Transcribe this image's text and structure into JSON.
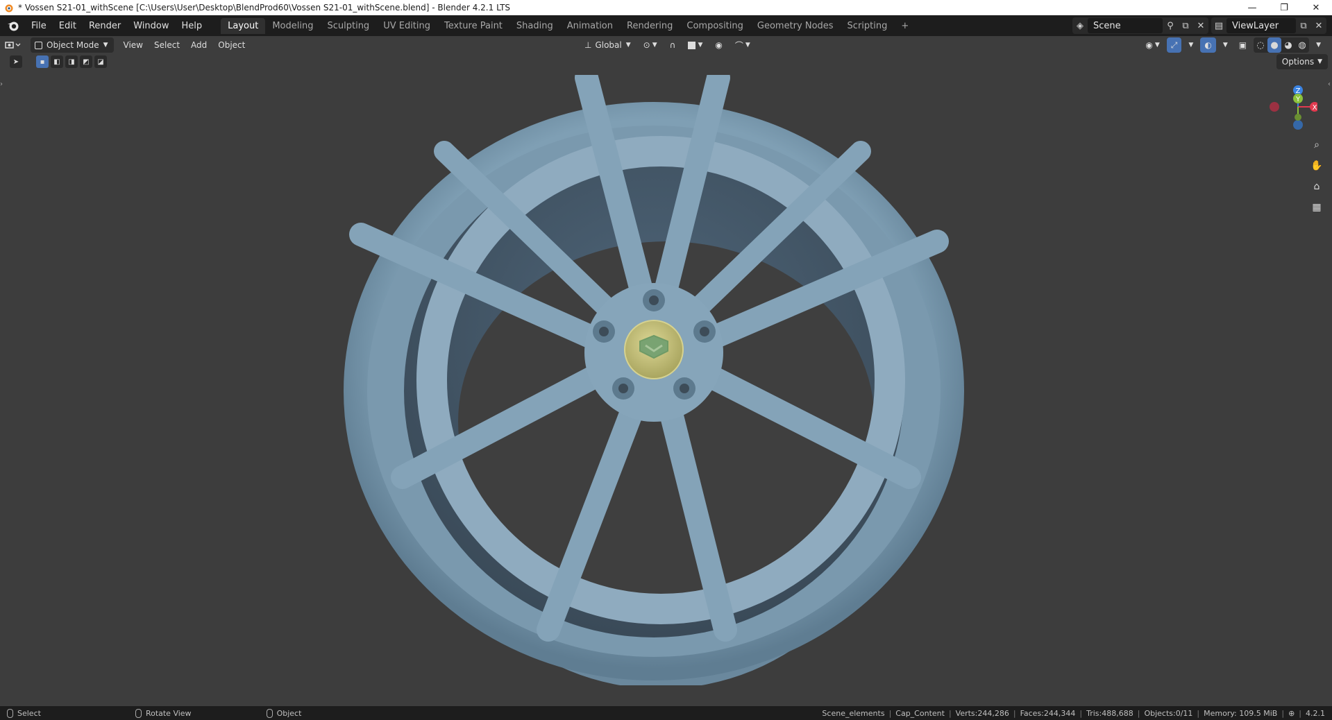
{
  "window": {
    "title": "* Vossen S21-01_withScene [C:\\Users\\User\\Desktop\\BlendProd60\\Vossen S21-01_withScene.blend] - Blender 4.2.1 LTS",
    "controls": [
      "—",
      "❐",
      "✕"
    ]
  },
  "menu": [
    "File",
    "Edit",
    "Render",
    "Window",
    "Help"
  ],
  "workspaces": [
    {
      "label": "Layout",
      "active": true
    },
    {
      "label": "Modeling"
    },
    {
      "label": "Sculpting"
    },
    {
      "label": "UV Editing"
    },
    {
      "label": "Texture Paint"
    },
    {
      "label": "Shading"
    },
    {
      "label": "Animation"
    },
    {
      "label": "Rendering"
    },
    {
      "label": "Compositing"
    },
    {
      "label": "Geometry Nodes"
    },
    {
      "label": "Scripting"
    }
  ],
  "workspace_add": "+",
  "scene": {
    "label": "Scene"
  },
  "view_layer": {
    "label": "ViewLayer"
  },
  "viewport_header": {
    "mode": "Object Mode",
    "menus": [
      "View",
      "Select",
      "Add",
      "Object"
    ],
    "transform_orientation": "Global"
  },
  "options_label": "Options",
  "gizmo": {
    "axes": [
      "X",
      "Y",
      "Z"
    ],
    "colors": {
      "x": "#e23a4f",
      "y": "#8bc13b",
      "z": "#3a83e2"
    }
  },
  "status": {
    "hints": [
      "Select",
      "Rotate View",
      "Object"
    ],
    "collection": "Scene_elements",
    "active": "Cap_Content",
    "verts": "Verts:244,286",
    "faces": "Faces:244,344",
    "tris": "Tris:488,688",
    "objects": "Objects:0/11",
    "memory": "Memory: 109.5 MiB",
    "version": "4.2.1"
  },
  "colors": {
    "wheel": "#7f9fb4",
    "cap": "#c9c582",
    "viewport_bg": "#3d3d3d"
  }
}
